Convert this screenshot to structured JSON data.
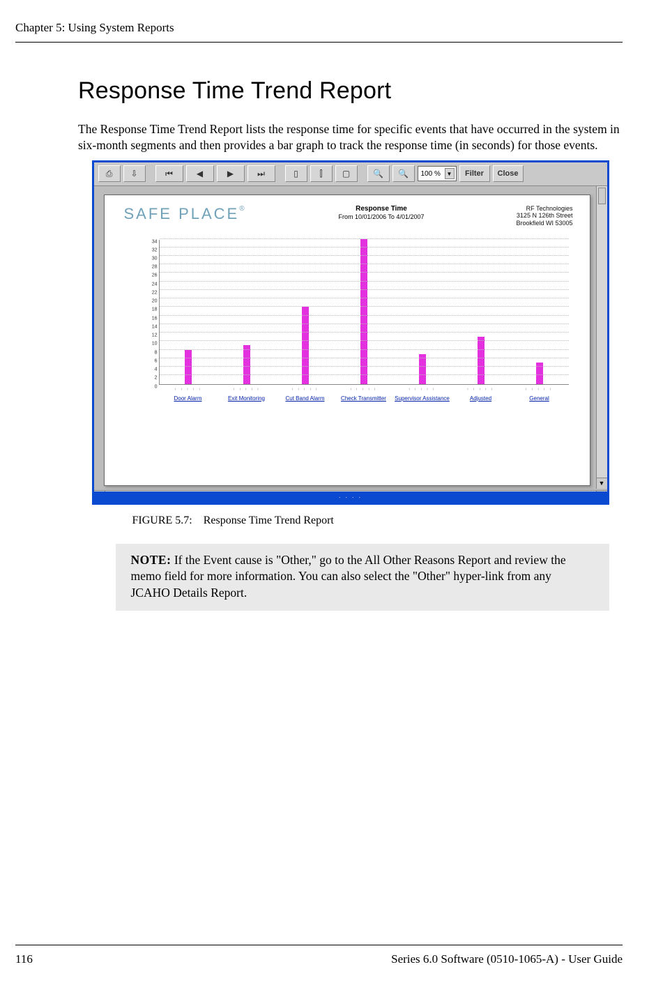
{
  "header": {
    "running_head": "Chapter 5: Using System Reports"
  },
  "section": {
    "title": "Response Time Trend Report",
    "paragraph": "The Response Time Trend Report lists the response time for specific events that have occurred in the system in six-month segments and then provides a bar graph to track the response time (in seconds) for those events."
  },
  "app": {
    "toolbar": {
      "print_icon": "⎙",
      "export_icon": "⇩",
      "first": "⏮",
      "prev": "◀",
      "next": "▶",
      "last": "⏭",
      "zoom_value": "100 %",
      "filter": "Filter",
      "close": "Close"
    },
    "report": {
      "brand": "SAFE PLACE",
      "brand_mark": "®",
      "title_line1": "Response Time",
      "title_line2": "From 10/01/2006 To 4/01/2007",
      "company_line1": "RF Technologies",
      "company_line2": "3125 N 126th Street",
      "company_line3": "Brookfield WI 53005"
    },
    "page_indicator": "·  ·  ·  ·"
  },
  "chart_data": {
    "type": "bar",
    "title": "Response Time From 10/01/2006 To 4/01/2007",
    "xlabel": "",
    "ylabel": "",
    "ylim": [
      0,
      34
    ],
    "y_ticks": [
      34,
      32,
      30,
      28,
      26,
      24,
      22,
      20,
      18,
      16,
      14,
      12,
      10,
      8,
      6,
      4,
      2,
      0
    ],
    "categories": [
      "Door Alarm",
      "Exit Monitoring",
      "Cut Band Alarm",
      "Check Transmitter",
      "Supervisor Assistance",
      "Adjusted",
      "General"
    ],
    "values": [
      8,
      9,
      18,
      34,
      7,
      11,
      5
    ],
    "mini_tick_label": "ᵢ ᵢ ᵢ ᵢ ᵢ"
  },
  "figure": {
    "caption_label": "FIGURE 5.7:",
    "caption_text": "Response Time Trend Report"
  },
  "note": {
    "label": "NOTE:",
    "text": " If the Event cause is \"Other,\" go to the All Other Reasons Report and review the memo field for more information. You can also select the \"Other\" hyper-link from any JCAHO Details Report."
  },
  "footer": {
    "page": "116",
    "doc": "Series 6.0 Software (0510-1065-A) - User Guide"
  }
}
